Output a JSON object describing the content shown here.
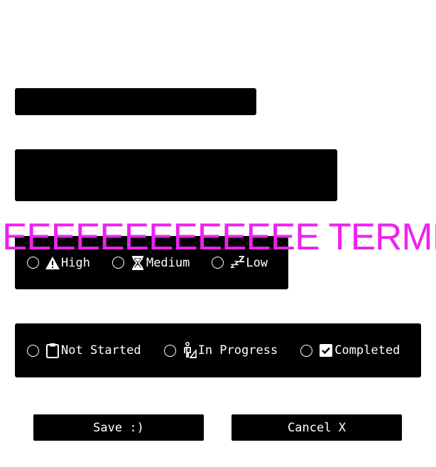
{
  "form": {
    "title_value": "",
    "description_value": ""
  },
  "priority": {
    "options": [
      {
        "label": "High",
        "icon": "warning-icon"
      },
      {
        "label": "Medium",
        "icon": "hourglass-icon"
      },
      {
        "label": "Low",
        "icon": "zzz-icon"
      }
    ]
  },
  "status": {
    "options": [
      {
        "label": "Not Started",
        "icon": "clipboard-icon"
      },
      {
        "label": "In Progress",
        "icon": "person-working-icon"
      },
      {
        "label": "Completed",
        "icon": "checkbox-checked-icon"
      }
    ]
  },
  "buttons": {
    "save_label": "Save :)",
    "cancel_label": "Cancel X"
  },
  "overlay": {
    "text": "EEEEEEEEEEEEE TERMINO"
  },
  "colors": {
    "field_background": "#000000",
    "text": "#ffffff",
    "overlay": "#ee22ee"
  }
}
